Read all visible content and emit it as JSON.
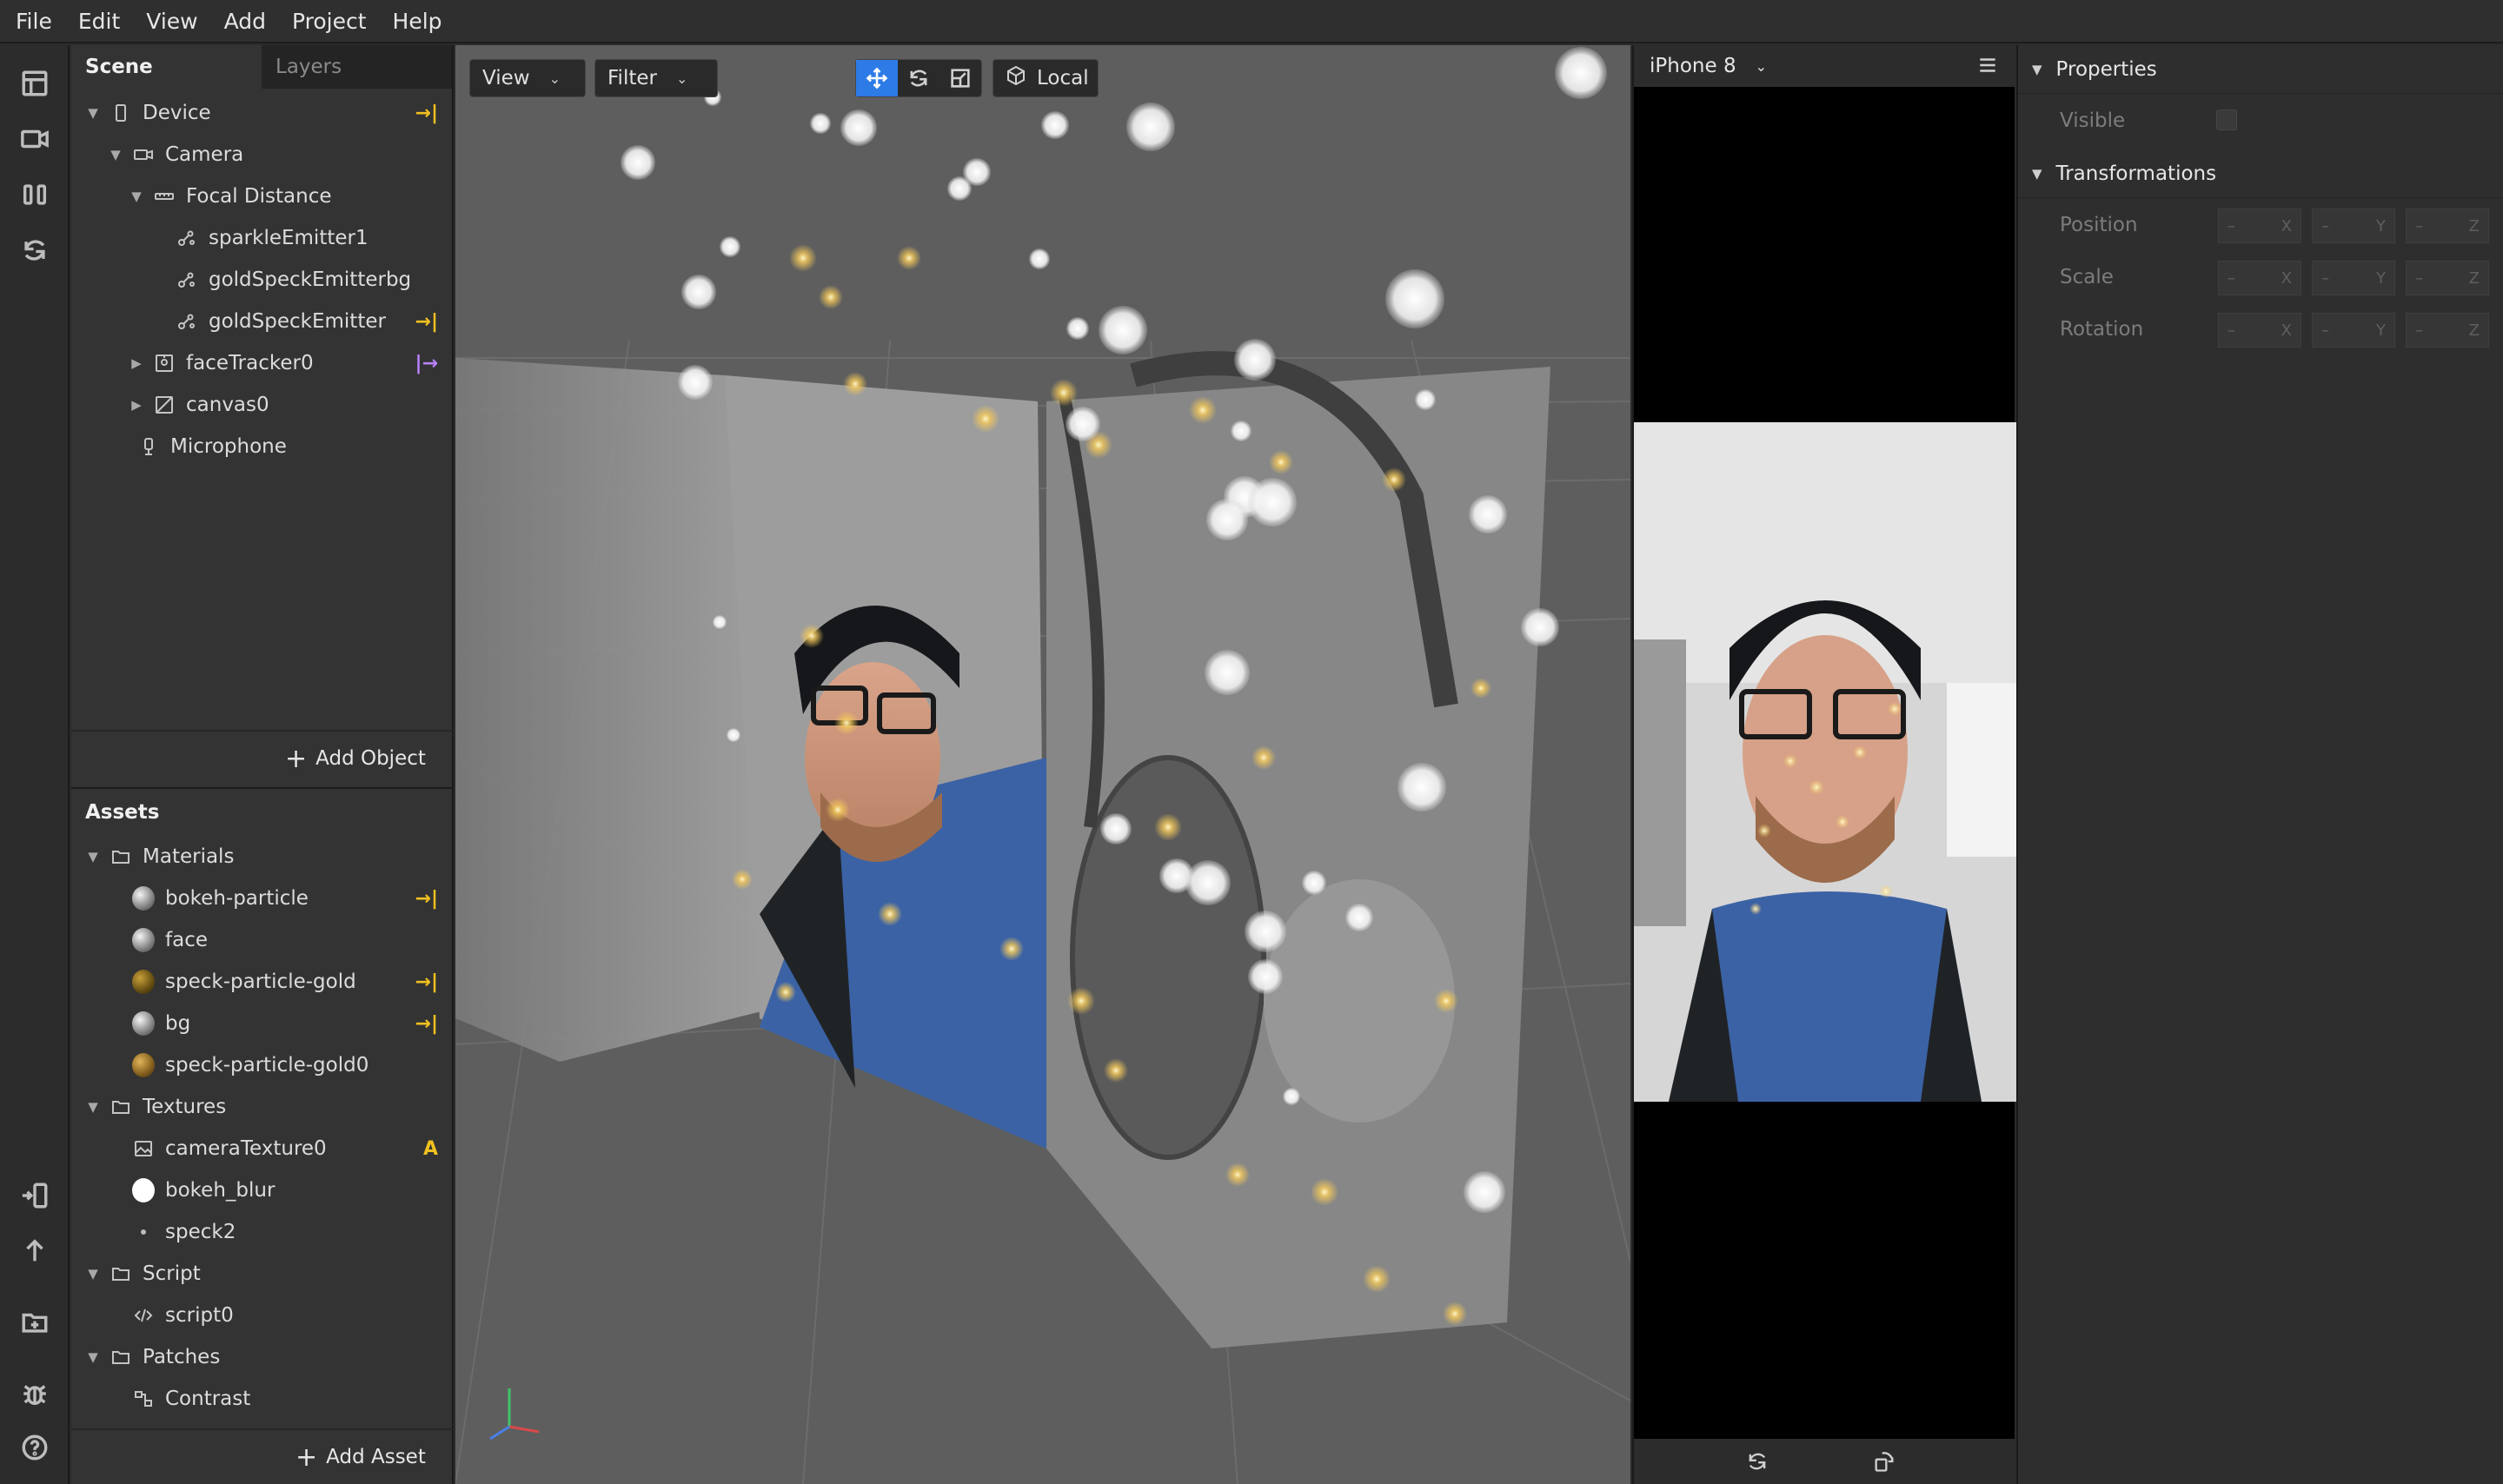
{
  "menu": [
    "File",
    "Edit",
    "View",
    "Add",
    "Project",
    "Help"
  ],
  "toolbar": {
    "icons": [
      "layout-icon",
      "video-icon",
      "pause-columns-icon",
      "refresh-icon",
      "device-send-icon",
      "upload-icon",
      "folder-add-icon",
      "bug-icon",
      "help-icon"
    ]
  },
  "scene": {
    "tab_scene": "Scene",
    "tab_layers": "Layers",
    "items": [
      {
        "label": "Device",
        "flag": "→|"
      },
      {
        "label": "Camera",
        "flag": ""
      },
      {
        "label": "Focal Distance",
        "flag": ""
      },
      {
        "label": "sparkleEmitter1",
        "flag": ""
      },
      {
        "label": "goldSpeckEmitterbg",
        "flag": ""
      },
      {
        "label": "goldSpeckEmitter",
        "flag": "→|"
      },
      {
        "label": "faceTracker0",
        "flag": "|→"
      },
      {
        "label": "canvas0",
        "flag": ""
      },
      {
        "label": "Microphone",
        "flag": ""
      }
    ],
    "add_object": "Add Object"
  },
  "assets": {
    "title": "Assets",
    "items": [
      {
        "label": "Materials",
        "flag": ""
      },
      {
        "label": "bokeh-particle",
        "flag": "→|"
      },
      {
        "label": "face",
        "flag": ""
      },
      {
        "label": "speck-particle-gold",
        "flag": "→|"
      },
      {
        "label": "bg",
        "flag": "→|"
      },
      {
        "label": "speck-particle-gold0",
        "flag": ""
      },
      {
        "label": "Textures",
        "flag": ""
      },
      {
        "label": "cameraTexture0",
        "flag": "A"
      },
      {
        "label": "bokeh_blur",
        "flag": ""
      },
      {
        "label": "speck2",
        "flag": ""
      },
      {
        "label": "Script",
        "flag": ""
      },
      {
        "label": "script0",
        "flag": ""
      },
      {
        "label": "Patches",
        "flag": ""
      },
      {
        "label": "Contrast",
        "flag": ""
      }
    ],
    "add_asset": "Add Asset"
  },
  "viewport": {
    "view_label": "View",
    "filter_label": "Filter",
    "space_label": "Local"
  },
  "preview": {
    "device": "iPhone 8"
  },
  "properties": {
    "title": "Properties",
    "visible_label": "Visible",
    "transformations_title": "Transformations",
    "rows": [
      {
        "label": "Position",
        "values": [
          "–",
          "–",
          "–"
        ],
        "axes": [
          "X",
          "Y",
          "Z"
        ]
      },
      {
        "label": "Scale",
        "values": [
          "–",
          "–",
          "–"
        ],
        "axes": [
          "X",
          "Y",
          "Z"
        ]
      },
      {
        "label": "Rotation",
        "values": [
          "–",
          "–",
          "–"
        ],
        "axes": [
          "X",
          "Y",
          "Z"
        ]
      }
    ]
  },
  "colors": {
    "accent": "#2d7be6",
    "flag_yellow": "#f0c020",
    "flag_purple": "#b982ff"
  }
}
